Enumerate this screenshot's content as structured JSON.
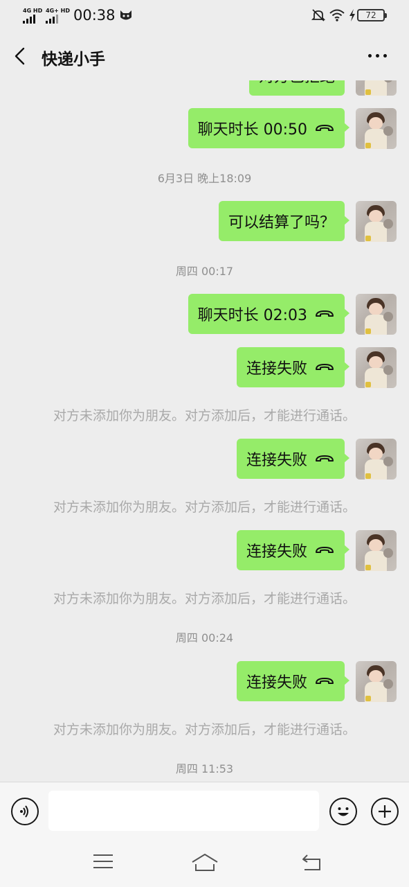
{
  "status_bar": {
    "network_1": "4G HD",
    "network_2": "4G+ HD",
    "time": "00:38",
    "battery": "72",
    "icons": [
      "signal-icon",
      "mascot-icon",
      "mute-bell-icon",
      "wifi-icon",
      "charging-icon",
      "battery-icon"
    ]
  },
  "header": {
    "title": "快递小手",
    "back_icon": "chevron-left-icon",
    "more_icon": "ellipsis-icon"
  },
  "chat": {
    "partial_message": "对方已拒绝",
    "messages": [
      {
        "kind": "bubble",
        "text": "聊天时长 00:50",
        "icon": "phone-hangup-icon"
      },
      {
        "kind": "time",
        "text": "6月3日 晚上18:09"
      },
      {
        "kind": "bubble",
        "text": "可以结算了吗？"
      },
      {
        "kind": "time",
        "text": "周四 00:17"
      },
      {
        "kind": "bubble",
        "text": "聊天时长 02:03",
        "icon": "phone-hangup-icon"
      },
      {
        "kind": "bubble",
        "text": "连接失败",
        "icon": "phone-hangup-icon"
      },
      {
        "kind": "system",
        "text": "对方未添加你为朋友。对方添加后，才能进行通话。"
      },
      {
        "kind": "bubble",
        "text": "连接失败",
        "icon": "phone-hangup-icon"
      },
      {
        "kind": "system",
        "text": "对方未添加你为朋友。对方添加后，才能进行通话。"
      },
      {
        "kind": "bubble",
        "text": "连接失败",
        "icon": "phone-hangup-icon"
      },
      {
        "kind": "system",
        "text": "对方未添加你为朋友。对方添加后，才能进行通话。"
      },
      {
        "kind": "time",
        "text": "周四 00:24"
      },
      {
        "kind": "bubble",
        "text": "连接失败",
        "icon": "phone-hangup-icon"
      },
      {
        "kind": "system",
        "text": "对方未添加你为朋友。对方添加后，才能进行通话。"
      },
      {
        "kind": "time",
        "text": "周四 11:53"
      }
    ]
  },
  "input_bar": {
    "input_value": "",
    "voice_icon": "voice-icon",
    "emoji_icon": "emoji-icon",
    "plus_icon": "plus-icon"
  },
  "system_nav": {
    "icons": [
      "menu-icon",
      "home-icon",
      "back-icon"
    ]
  },
  "colors": {
    "background": "#ededed",
    "bubble": "#95ec69",
    "system_text": "#a9a9a9",
    "timestamp_text": "#8f8f8f"
  }
}
